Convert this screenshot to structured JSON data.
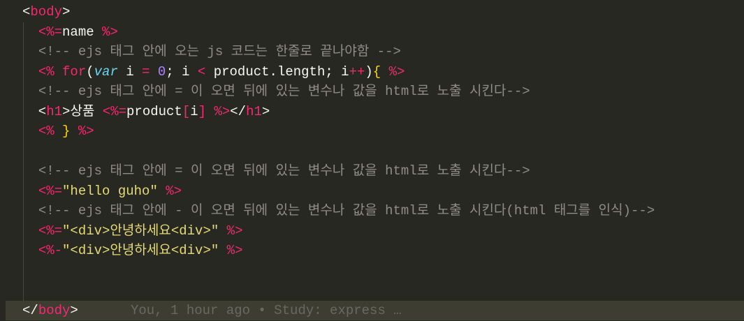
{
  "theme": {
    "background": "#272822",
    "current_line": "#3e3d32",
    "indent_guide": "#464741",
    "colors": {
      "plain": "#f8f8f2",
      "tag": "#f92672",
      "keyword": "#f92672",
      "storage": "#66d9ef",
      "number": "#ae81ff",
      "string": "#e6db74",
      "brace": "#ffd700",
      "comment": "#8f8d84",
      "blame": "#6a6960"
    }
  },
  "editor": {
    "lines": [
      {
        "tokens": [
          {
            "type": "plain",
            "text": "<"
          },
          {
            "type": "tag",
            "text": "body"
          },
          {
            "type": "plain",
            "text": ">"
          }
        ]
      },
      {
        "tokens": [
          {
            "type": "plain",
            "text": "  "
          },
          {
            "type": "tag",
            "text": "<%="
          },
          {
            "type": "plain",
            "text": "name "
          },
          {
            "type": "tag",
            "text": "%>"
          }
        ]
      },
      {
        "tokens": [
          {
            "type": "plain",
            "text": "  "
          },
          {
            "type": "comment",
            "text": "<!-- ejs 태그 안에 오는 js 코드는 한줄로 끝나야함 -->"
          }
        ]
      },
      {
        "tokens": [
          {
            "type": "plain",
            "text": "  "
          },
          {
            "type": "tag",
            "text": "<%"
          },
          {
            "type": "plain",
            "text": " "
          },
          {
            "type": "keyword",
            "text": "for"
          },
          {
            "type": "plain",
            "text": "("
          },
          {
            "type": "storage",
            "text": "var"
          },
          {
            "type": "plain",
            "text": " i "
          },
          {
            "type": "keyword",
            "text": "="
          },
          {
            "type": "plain",
            "text": " "
          },
          {
            "type": "number",
            "text": "0"
          },
          {
            "type": "plain",
            "text": "; i "
          },
          {
            "type": "keyword",
            "text": "<"
          },
          {
            "type": "plain",
            "text": " product.length; i"
          },
          {
            "type": "keyword",
            "text": "++"
          },
          {
            "type": "plain",
            "text": ")"
          },
          {
            "type": "brace",
            "text": "{"
          },
          {
            "type": "plain",
            "text": " "
          },
          {
            "type": "tag",
            "text": "%>"
          }
        ]
      },
      {
        "tokens": [
          {
            "type": "plain",
            "text": "  "
          },
          {
            "type": "comment",
            "text": "<!-- ejs 태그 안에 = 이 오면 뒤에 있는 변수나 값을 html로 노출 시킨다-->"
          }
        ]
      },
      {
        "tokens": [
          {
            "type": "plain",
            "text": "  <"
          },
          {
            "type": "tag",
            "text": "h1"
          },
          {
            "type": "plain",
            "text": ">상품 "
          },
          {
            "type": "tag",
            "text": "<%="
          },
          {
            "type": "plain",
            "text": "product"
          },
          {
            "type": "keyword",
            "text": "["
          },
          {
            "type": "plain",
            "text": "i"
          },
          {
            "type": "keyword",
            "text": "]"
          },
          {
            "type": "plain",
            "text": " "
          },
          {
            "type": "tag",
            "text": "%>"
          },
          {
            "type": "plain",
            "text": "</"
          },
          {
            "type": "tag",
            "text": "h1"
          },
          {
            "type": "plain",
            "text": ">"
          }
        ]
      },
      {
        "tokens": [
          {
            "type": "plain",
            "text": "  "
          },
          {
            "type": "tag",
            "text": "<%"
          },
          {
            "type": "plain",
            "text": " "
          },
          {
            "type": "brace",
            "text": "}"
          },
          {
            "type": "plain",
            "text": " "
          },
          {
            "type": "tag",
            "text": "%>"
          }
        ]
      },
      {
        "tokens": []
      },
      {
        "tokens": [
          {
            "type": "plain",
            "text": "  "
          },
          {
            "type": "comment",
            "text": "<!-- ejs 태그 안에 = 이 오면 뒤에 있는 변수나 값을 html로 노출 시킨다-->"
          }
        ]
      },
      {
        "tokens": [
          {
            "type": "plain",
            "text": "  "
          },
          {
            "type": "tag",
            "text": "<%="
          },
          {
            "type": "string",
            "text": "\"hello guho\""
          },
          {
            "type": "plain",
            "text": " "
          },
          {
            "type": "tag",
            "text": "%>"
          }
        ]
      },
      {
        "tokens": [
          {
            "type": "plain",
            "text": "  "
          },
          {
            "type": "comment",
            "text": "<!-- ejs 태그 안에 - 이 오면 뒤에 있는 변수나 값을 html로 노출 시킨다(html 태그를 인식)-->"
          }
        ]
      },
      {
        "tokens": [
          {
            "type": "plain",
            "text": "  "
          },
          {
            "type": "tag",
            "text": "<%="
          },
          {
            "type": "string",
            "text": "\"<div>안녕하세요<div>\""
          },
          {
            "type": "plain",
            "text": " "
          },
          {
            "type": "tag",
            "text": "%>"
          }
        ]
      },
      {
        "tokens": [
          {
            "type": "plain",
            "text": "  "
          },
          {
            "type": "tag",
            "text": "<%-"
          },
          {
            "type": "string",
            "text": "\"<div>안녕하세요<div>\""
          },
          {
            "type": "plain",
            "text": " "
          },
          {
            "type": "tag",
            "text": "%>"
          }
        ]
      },
      {
        "tokens": []
      },
      {
        "tokens": []
      },
      {
        "current": true,
        "tokens": [
          {
            "type": "plain",
            "text": "</"
          },
          {
            "type": "tag",
            "text": "body"
          },
          {
            "type": "plain",
            "text": ">"
          }
        ],
        "blame": "You, 1 hour ago • Study: express …"
      }
    ]
  }
}
